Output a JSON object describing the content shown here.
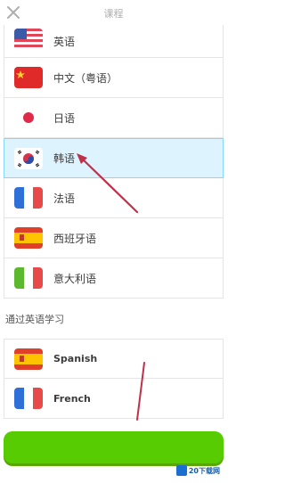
{
  "header": {
    "title": "课程"
  },
  "languages": [
    {
      "label": "英语",
      "flag": "us-flag-icon"
    },
    {
      "label": "中文（粤语）",
      "flag": "cn-flag-icon"
    },
    {
      "label": "日语",
      "flag": "jp-flag-icon"
    },
    {
      "label": "韩语",
      "flag": "kr-flag-icon",
      "selected": true
    },
    {
      "label": "法语",
      "flag": "fr-flag-icon"
    },
    {
      "label": "西班牙语",
      "flag": "es-flag-icon"
    },
    {
      "label": "意大利语",
      "flag": "it-flag-icon"
    }
  ],
  "section": {
    "title": "通过英语学习"
  },
  "english_courses": [
    {
      "label": "Spanish",
      "flag": "es-flag-icon"
    },
    {
      "label": "French",
      "flag": "fr-flag-icon"
    }
  ],
  "watermark": "20下载网",
  "colors": {
    "selected_bg": "#ddf4ff",
    "selected_border": "#84d8ff",
    "button": "#58cc02",
    "annotation_arrow": "#c0304a"
  }
}
